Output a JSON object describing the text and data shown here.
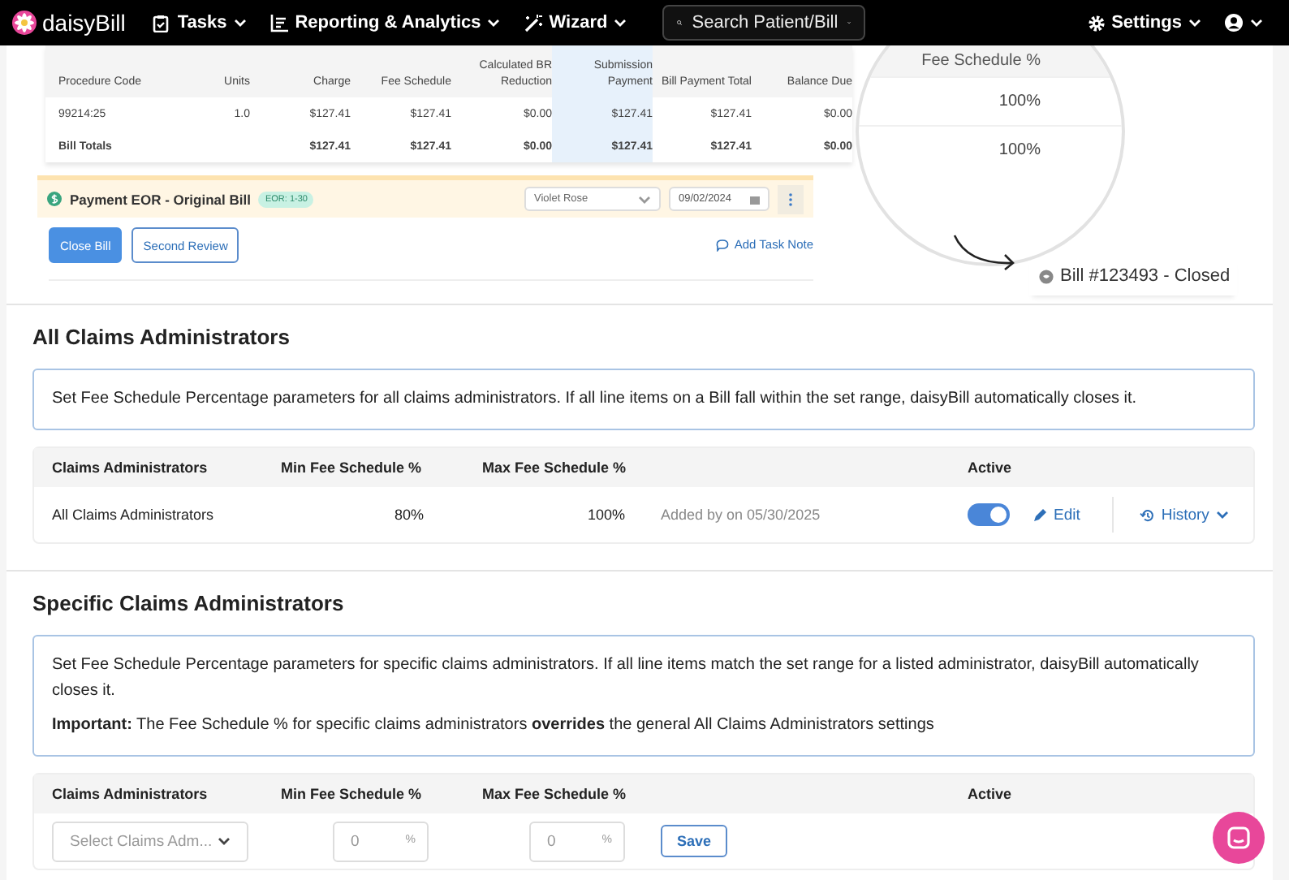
{
  "nav": {
    "logo": "daisyBill",
    "menus": [
      {
        "kind": "tasks",
        "label": "Tasks"
      },
      {
        "kind": "reports",
        "label": "Reporting & Analytics"
      },
      {
        "kind": "wizard",
        "label": "Wizard"
      }
    ],
    "search": {
      "placeholder": "Search Patient/Bill"
    },
    "settings": "Settings"
  },
  "demo": {
    "table": {
      "columns": [
        "Procedure Code",
        "Units",
        "Charge",
        "Fee Schedule",
        "Calculated BR Reduction",
        "Submission Payment",
        "Bill Payment Total",
        "Balance Due"
      ],
      "rows": [
        {
          "kind": "line",
          "cells": [
            "99214:25",
            "1.0",
            "$127.41",
            "$127.41",
            "$0.00",
            "$127.41",
            "$127.41",
            "$0.00"
          ]
        },
        {
          "kind": "total",
          "cells": [
            "Bill Totals",
            "",
            "$127.41",
            "$127.41",
            "$0.00",
            "$127.41",
            "$127.41",
            "$0.00"
          ]
        }
      ]
    },
    "eor": {
      "title": "Payment EOR - Original Bill",
      "badge": "EOR: 1-30",
      "assignee": "Violet Rose",
      "date": "09/02/2024"
    },
    "buttons": [
      {
        "kind": "primary",
        "label": "Close Bill"
      },
      {
        "kind": "outline",
        "label": "Second Review"
      }
    ],
    "note_link": "Add Task Note",
    "magnifier": {
      "header": "Fee Schedule %",
      "values": [
        "100%",
        "100%"
      ]
    },
    "status": "Bill #123493 - Closed"
  },
  "sections": [
    {
      "kind": "general",
      "title": "All Claims Administrators",
      "info": [
        "Set Fee Schedule Percentage parameters for all claims administrators. If all line items on a Bill fall within the set range, daisyBill automatically closes it."
      ],
      "columns": [
        "Claims Administrators",
        "Min Fee Schedule %",
        "Max Fee Schedule %",
        "Active"
      ],
      "row": {
        "name": "All Claims Administrators",
        "min": "80%",
        "max": "100%",
        "added": "Added by on 05/30/2025",
        "active": true,
        "edit": "Edit",
        "history": "History"
      }
    },
    {
      "kind": "specific",
      "title": "Specific Claims Administrators",
      "info": [
        "Set Fee Schedule Percentage parameters for specific claims administrators. If all line items match the set range for a listed administrator, daisyBill automatically closes it.",
        "**Important:** The Fee Schedule % for specific claims administrators **overrides** the general All Claims Administrators settings"
      ],
      "columns": [
        "Claims Administrators",
        "Min Fee Schedule %",
        "Max Fee Schedule %",
        "Active"
      ],
      "form": {
        "select": "Select Claims Adm...",
        "min": {
          "placeholder": "0"
        },
        "max": {
          "placeholder": "0"
        },
        "suffix": "%",
        "save": "Save"
      }
    }
  ]
}
